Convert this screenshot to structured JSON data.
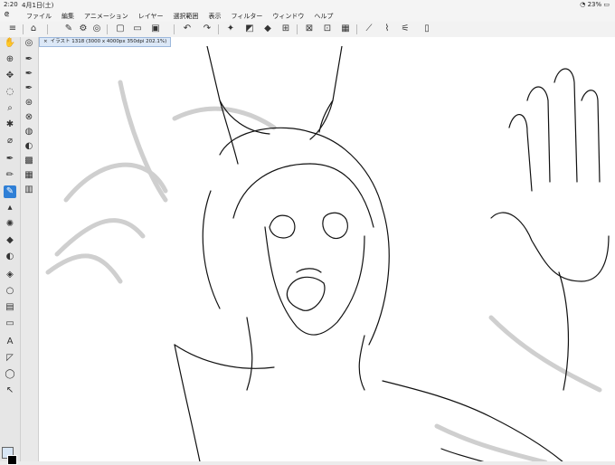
{
  "status": {
    "time": "2:20",
    "date": "4月1日(土)",
    "battery": "23%"
  },
  "menu": {
    "items": [
      "ファイル",
      "編集",
      "アニメーション",
      "レイヤー",
      "選択範囲",
      "表示",
      "フィルター",
      "ウィンドウ",
      "ヘルプ"
    ]
  },
  "document": {
    "tab_title": "イラスト 1318 (3000 x 4000px 350dpi 202.1%)",
    "close_symbol": "×"
  }
}
